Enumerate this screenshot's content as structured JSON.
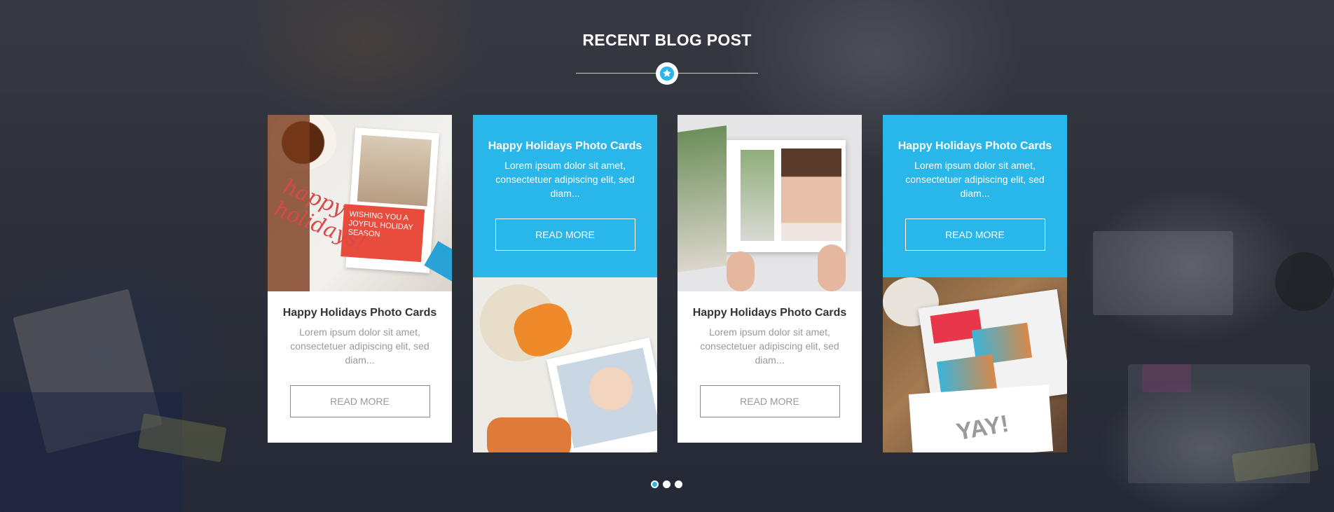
{
  "section": {
    "title": "RECENT BLOG POST"
  },
  "colors": {
    "accent": "#29b6e8",
    "card_white": "#ffffff",
    "title_text": "#ffffff"
  },
  "icons": {
    "divider": "star-icon"
  },
  "posts": [
    {
      "style": "white",
      "image": "holiday-card-with-tea",
      "image_text": "happy holidays!",
      "image_card_text": "WISHING YOU A JOYFUL HOLIDAY SEASON",
      "title": "Happy Holidays Photo Cards",
      "excerpt": "Lorem ipsum dolor sit amet, consectetuer adipiscing elit, sed diam...",
      "button": "READ MORE"
    },
    {
      "style": "blue",
      "image": "baby-photo-book-with-toys",
      "title": "Happy Holidays Photo Cards",
      "excerpt": "Lorem ipsum dolor sit amet, consectetuer adipiscing elit, sed diam...",
      "button": "READ MORE"
    },
    {
      "style": "white",
      "image": "wedding-photo-book",
      "title": "Happy Holidays Photo Cards",
      "excerpt": "Lorem ipsum dolor sit amet, consectetuer adipiscing elit, sed diam...",
      "button": "READ MORE"
    },
    {
      "style": "blue",
      "image": "dog-photo-cards-envelopes",
      "image_text": "YAY!",
      "title": "Happy Holidays Photo Cards",
      "excerpt": "Lorem ipsum dolor sit amet, consectetuer adipiscing elit, sed diam...",
      "button": "READ MORE"
    }
  ],
  "pagination": {
    "count": 3,
    "active": 0
  }
}
